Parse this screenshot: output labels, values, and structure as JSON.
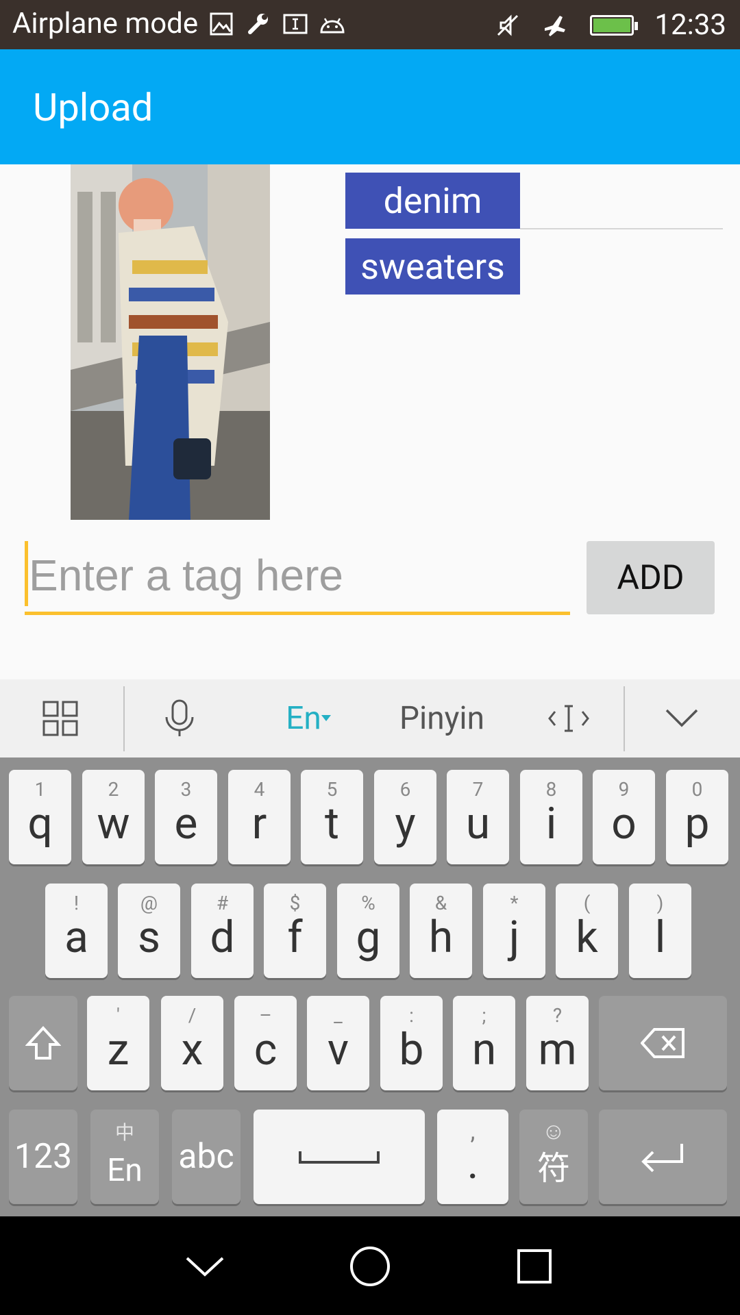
{
  "status_bar": {
    "mode_text": "Airplane mode",
    "time": "12:33",
    "icons": [
      "gallery-icon",
      "wrench-icon",
      "text-icon",
      "android-icon",
      "mute-icon",
      "airplane-icon",
      "battery-icon"
    ]
  },
  "app_bar": {
    "title": "Upload"
  },
  "tags": [
    "denim",
    "sweaters"
  ],
  "tag_input": {
    "placeholder": "Enter a tag here",
    "value": ""
  },
  "add_button": {
    "label": "ADD"
  },
  "keyboard_toolbar": {
    "lang_active": "En",
    "lang_alt": "Pinyin"
  },
  "keyboard": {
    "row1": [
      {
        "main": "q",
        "sub": "1"
      },
      {
        "main": "w",
        "sub": "2"
      },
      {
        "main": "e",
        "sub": "3"
      },
      {
        "main": "r",
        "sub": "4"
      },
      {
        "main": "t",
        "sub": "5"
      },
      {
        "main": "y",
        "sub": "6"
      },
      {
        "main": "u",
        "sub": "7"
      },
      {
        "main": "i",
        "sub": "8"
      },
      {
        "main": "o",
        "sub": "9"
      },
      {
        "main": "p",
        "sub": "0"
      }
    ],
    "row2": [
      {
        "main": "a",
        "sub": "!"
      },
      {
        "main": "s",
        "sub": "@"
      },
      {
        "main": "d",
        "sub": "#"
      },
      {
        "main": "f",
        "sub": "$"
      },
      {
        "main": "g",
        "sub": "%"
      },
      {
        "main": "h",
        "sub": "&"
      },
      {
        "main": "j",
        "sub": "*"
      },
      {
        "main": "k",
        "sub": "("
      },
      {
        "main": "l",
        "sub": ")"
      }
    ],
    "row3": [
      {
        "main": "z",
        "sub": "'"
      },
      {
        "main": "x",
        "sub": "/"
      },
      {
        "main": "c",
        "sub": "–"
      },
      {
        "main": "v",
        "sub": "_"
      },
      {
        "main": "b",
        "sub": ":"
      },
      {
        "main": "n",
        "sub": ";"
      },
      {
        "main": "m",
        "sub": "?"
      }
    ],
    "num_key": "123",
    "lang_key_main": "En",
    "lang_key_sub": "中",
    "abc_key": "abc",
    "period_key_main": ".",
    "period_key_sub": ",",
    "symbol_key_main": "符",
    "symbol_key_sub": "☺"
  },
  "colors": {
    "app_bar": "#03a9f4",
    "tag_chip": "#3f51b5",
    "input_accent": "#fbc02d",
    "keyboard_active": "#24b0c4"
  }
}
